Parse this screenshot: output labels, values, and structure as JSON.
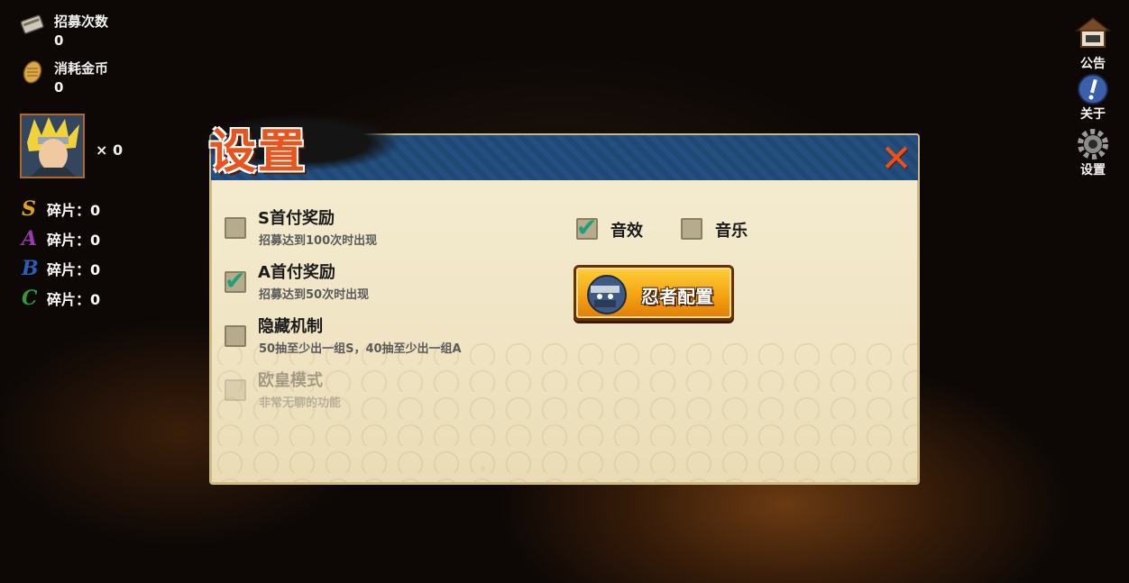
{
  "hud": {
    "recruit_label": "招募次数",
    "recruit_value": "0",
    "coin_label": "消耗金币",
    "coin_value": "0",
    "portrait_count": "× 0",
    "fragments": [
      {
        "letter": "S",
        "label": "碎片：0",
        "color": "#e0a21a"
      },
      {
        "letter": "A",
        "label": "碎片：0",
        "color": "#9a3ab0"
      },
      {
        "letter": "B",
        "label": "碎片：0",
        "color": "#2a5fb8"
      },
      {
        "letter": "C",
        "label": "碎片：0",
        "color": "#2e9a3a"
      }
    ]
  },
  "right_menu": {
    "notice": "公告",
    "about": "关于",
    "settings": "设置"
  },
  "dialog": {
    "title": "设置",
    "close_icon": "close-x-icon",
    "options": [
      {
        "title": "S首付奖励",
        "subtitle": "招募达到100次时出现",
        "checked": false,
        "disabled": false
      },
      {
        "title": "A首付奖励",
        "subtitle": "招募达到50次时出现",
        "checked": true,
        "disabled": false
      },
      {
        "title": "隐藏机制",
        "subtitle": "50抽至少出一组S，40抽至少出一组A",
        "checked": false,
        "disabled": false
      },
      {
        "title": "欧皇模式",
        "subtitle": "非常无聊的功能",
        "checked": false,
        "disabled": true
      }
    ],
    "sound_effects": {
      "label": "音效",
      "checked": true
    },
    "music": {
      "label": "音乐",
      "checked": false
    },
    "ninja_config_label": "忍者配置"
  },
  "colors": {
    "accent_orange": "#e8541c",
    "header_blue": "#1f4874",
    "check_green": "#1fa07a"
  }
}
